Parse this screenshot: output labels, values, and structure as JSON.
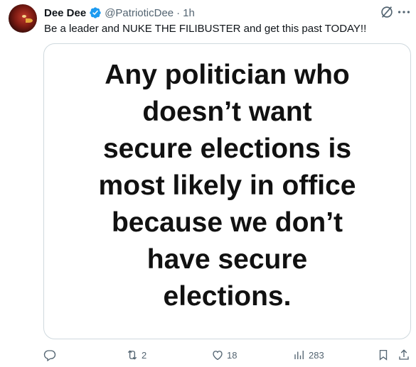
{
  "tweet": {
    "author_name": "Dee Dee",
    "handle": "@PatrioticDee",
    "separator": "·",
    "time": "1h",
    "text": "Be a leader and NUKE THE FILIBUSTER and get this past TODAY!!",
    "image_text_lines": [
      "Any politician who",
      "doesn’t want",
      "secure elections is",
      "most likely in office",
      "because we don’t",
      "have secure",
      "elections."
    ]
  },
  "actions": {
    "reply_count": "",
    "retweet_count": "2",
    "like_count": "18",
    "views_count": "283"
  },
  "icons": [
    "avatar",
    "verified-badge-icon",
    "grok-icon",
    "more-icon",
    "reply-icon",
    "retweet-icon",
    "like-icon",
    "views-icon",
    "bookmark-icon",
    "share-icon"
  ],
  "colors": {
    "verified": "#1d9bf0",
    "muted": "#536471",
    "text": "#0f1419",
    "border": "#cfd9de"
  }
}
